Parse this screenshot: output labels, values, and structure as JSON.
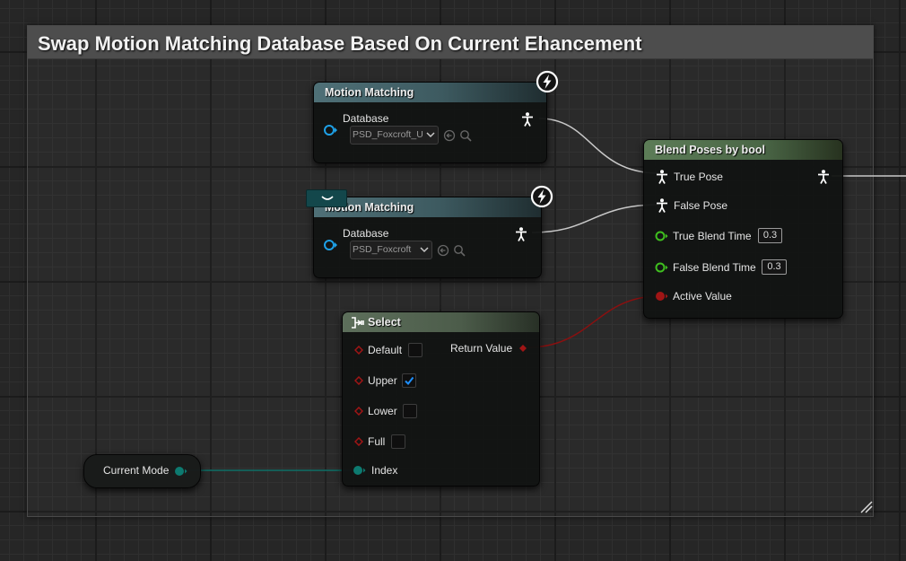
{
  "comment": {
    "title": "Swap Motion Matching Database Based On Current Ehancement"
  },
  "motion_matching_1": {
    "title": "Motion Matching",
    "database_label": "Database",
    "database_value": "PSD_Foxcroft_U"
  },
  "motion_matching_2": {
    "title": "Motion Matching",
    "database_label": "Database",
    "database_value": "PSD_Foxcroft"
  },
  "blend_poses": {
    "title": "Blend Poses by bool",
    "true_pose_label": "True Pose",
    "false_pose_label": "False Pose",
    "true_blend_label": "True Blend Time",
    "true_blend_value": "0.3",
    "false_blend_label": "False Blend Time",
    "false_blend_value": "0.3",
    "active_value_label": "Active Value"
  },
  "select": {
    "title": "Select",
    "return_value_label": "Return Value",
    "options": [
      {
        "label": "Default",
        "checked": false
      },
      {
        "label": "Upper",
        "checked": true
      },
      {
        "label": "Lower",
        "checked": false
      },
      {
        "label": "Full",
        "checked": false
      }
    ],
    "index_label": "Index"
  },
  "current_mode": {
    "label": "Current Mode"
  },
  "colors": {
    "pose_wire": "#c8c8c8",
    "bool_wire": "#8a1010",
    "enum_wire": "#0c6e66",
    "float_pin": "#3fbf1f",
    "object_pin": "#1ea0e6",
    "bool_pin": "#a01515",
    "enum_pin": "#0d7a70"
  },
  "icons": {
    "pose_pin": "person-icon",
    "fast_path": "lightning-icon",
    "select_node": "select-icon",
    "collapse_toggle": "chevron-up-icon"
  }
}
